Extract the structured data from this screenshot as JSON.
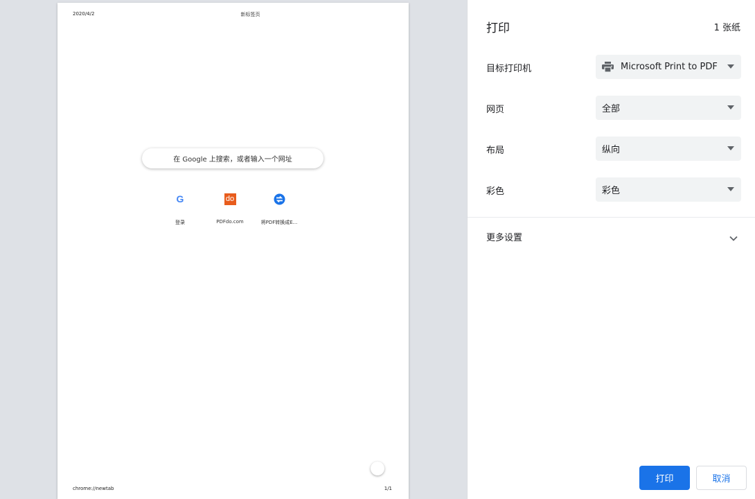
{
  "preview": {
    "header_date": "2020/4/2",
    "header_title": "新标签页",
    "footer_url": "chrome://newtab",
    "footer_page": "1/1",
    "search_placeholder": "在 Google 上搜索，或者输入一个网址",
    "shortcuts": [
      {
        "label": "登录",
        "icon": "google-g-icon",
        "glyph": "G"
      },
      {
        "label": "PDFdo.com",
        "icon": "pdfdo-icon",
        "glyph": "do"
      },
      {
        "label": "将PDF转换成E...",
        "icon": "converter-icon"
      }
    ]
  },
  "settings": {
    "title": "打印",
    "sheet_count": "1 张纸",
    "destination": {
      "label": "目标打印机",
      "value": "Microsoft Print to PDF",
      "icon": "printer-icon"
    },
    "pages": {
      "label": "网页",
      "value": "全部"
    },
    "layout": {
      "label": "布局",
      "value": "纵向"
    },
    "color": {
      "label": "彩色",
      "value": "彩色"
    },
    "more_settings": "更多设置"
  },
  "actions": {
    "print": "打印",
    "cancel": "取消"
  },
  "colors": {
    "accent": "#1a73e8",
    "preview_background": "#dee1e6",
    "select_background": "#f1f3f4",
    "pdfdo_brand": "#e85c1c"
  }
}
